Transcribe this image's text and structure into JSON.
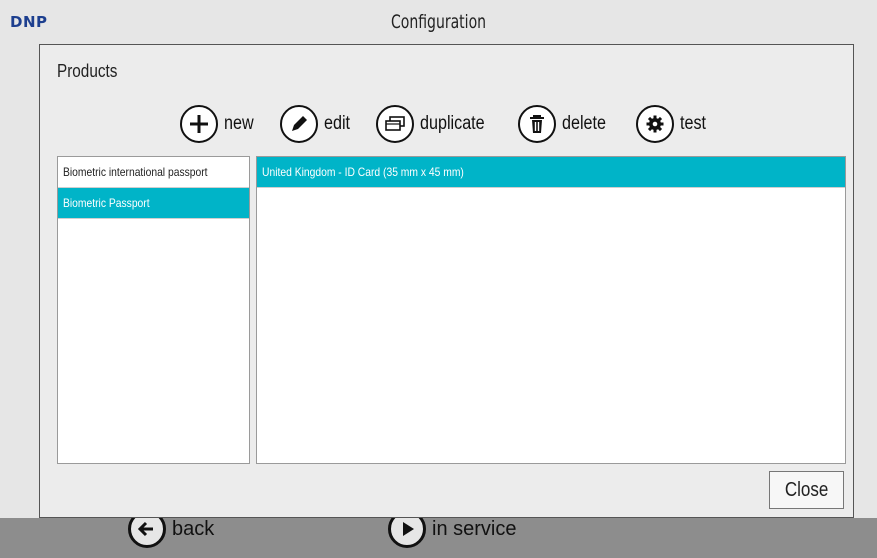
{
  "app": {
    "logo": "DNP",
    "title": "Configuration"
  },
  "background_buttons": [
    {
      "label": "back",
      "icon": "arrow-left-icon"
    },
    {
      "label": "in service",
      "icon": "play-icon"
    }
  ],
  "dialog": {
    "title": "Products",
    "toolbar": [
      {
        "label": "new",
        "icon": "plus-icon"
      },
      {
        "label": "edit",
        "icon": "pencil-icon"
      },
      {
        "label": "duplicate",
        "icon": "duplicate-icon"
      },
      {
        "label": "delete",
        "icon": "trash-icon"
      },
      {
        "label": "test",
        "icon": "gear-icon"
      }
    ],
    "products": [
      {
        "label": "Biometric international passport",
        "selected": false
      },
      {
        "label": "Biometric Passport",
        "selected": true
      }
    ],
    "formats": [
      {
        "label": "United Kingdom - ID Card (35 mm x 45 mm)",
        "selected": true
      }
    ],
    "close_label": "Close"
  },
  "colors": {
    "accent": "#00b4c8",
    "logo": "#1d3f8f"
  }
}
